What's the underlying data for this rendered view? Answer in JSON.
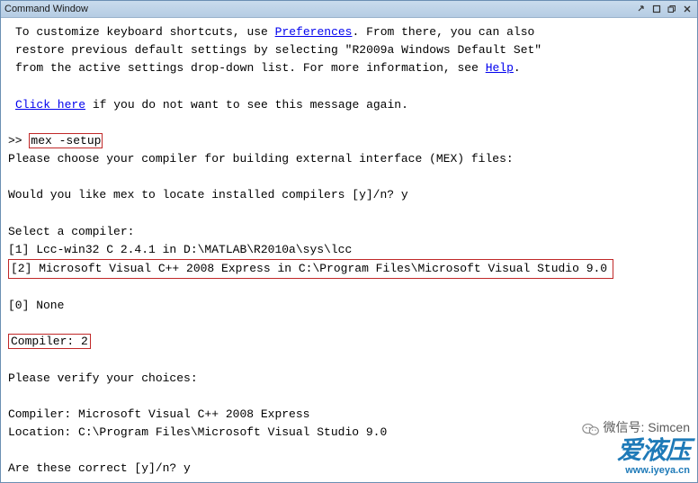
{
  "window": {
    "title": "Command Window"
  },
  "intro": {
    "line1a": "To customize keyboard shortcuts, use ",
    "link_pref": "Preferences",
    "line1b": ". From there, you can also",
    "line2": "restore previous default settings by selecting \"R2009a Windows Default Set\"",
    "line3a": "from the active settings drop-down list. For more information, see ",
    "link_help": "Help",
    "line3b": ".",
    "click_here": "Click here",
    "click_rest": " if you do not want to see this message again."
  },
  "session": {
    "prompt": ">> ",
    "cmd": "mex -setup",
    "please_choose": "Please choose your compiler for building external interface (MEX) files:",
    "locate_q": "Would you like mex to locate installed compilers [y]/n? y",
    "select_header": "Select a compiler:",
    "opt1": "[1] Lcc-win32 C 2.4.1 in D:\\MATLAB\\R2010a\\sys\\lcc",
    "opt2": "[2] Microsoft Visual C++ 2008 Express in C:\\Program Files\\Microsoft Visual Studio 9.0",
    "opt0": "[0] None",
    "compiler_ans": "Compiler: 2",
    "verify": "Please verify your choices:",
    "verify_compiler": "Compiler: Microsoft Visual C++ 2008 Express",
    "verify_location": "Location: C:\\Program Files\\Microsoft Visual Studio 9.0",
    "correct_q": "Are these correct [y]/n? y"
  },
  "watermark": {
    "wechat_label": "微信号: Simcen",
    "logo": "爱液压",
    "url": "www.iyeya.cn"
  }
}
